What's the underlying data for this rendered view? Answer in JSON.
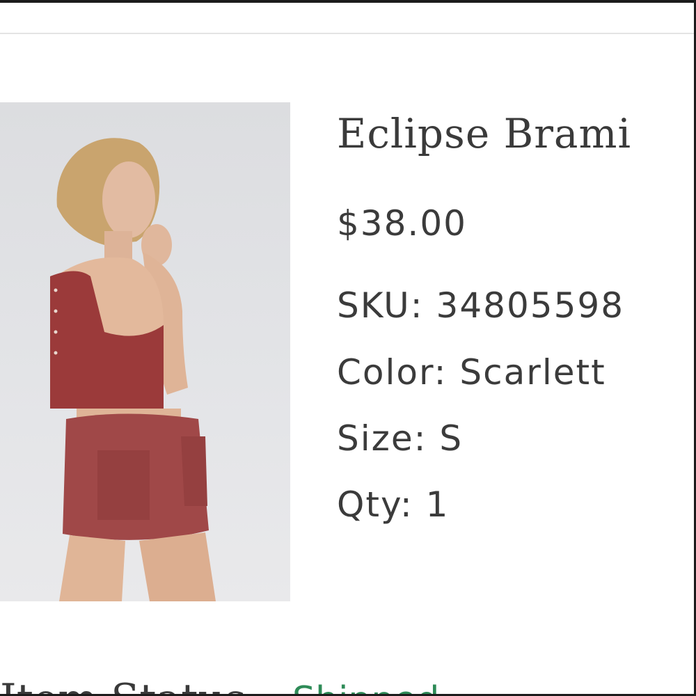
{
  "product": {
    "name": "Eclipse Brami",
    "price": "$38.00",
    "sku": "SKU: 34805598",
    "color": "Color: Scarlett",
    "size": "Size: S",
    "qty": "Qty: 1"
  },
  "order_status": {
    "label": "Item Status:",
    "value": "Shipped"
  },
  "colors": {
    "text": "#3b3b3b",
    "status_green": "#2e8b57",
    "garment": "#9b3a3a"
  }
}
